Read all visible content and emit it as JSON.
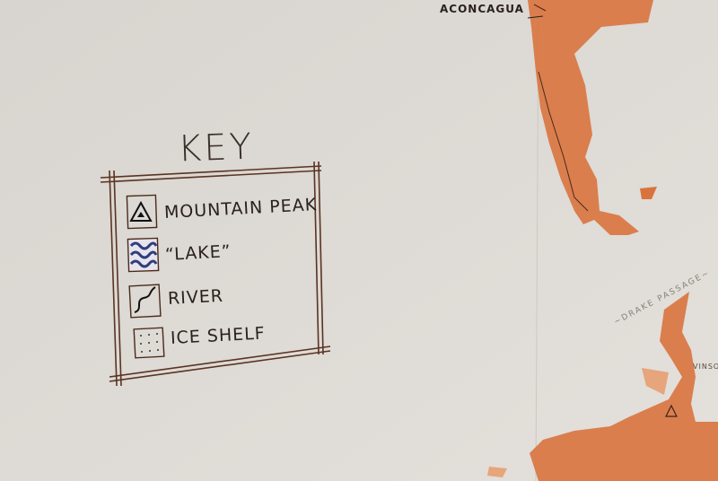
{
  "key": {
    "title": "KEY",
    "items": [
      {
        "label": "MOUNTAIN PEAK",
        "icon": "mountain-peak-icon"
      },
      {
        "label": "“LAKE”",
        "icon": "lake-icon"
      },
      {
        "label": "RIVER",
        "icon": "river-icon"
      },
      {
        "label": "ICE SHELF",
        "icon": "ice-shelf-icon"
      }
    ]
  },
  "map_labels": {
    "aconcagua": "ACONCAGUA",
    "drake_passage": "~DRAKE PASSAGE~",
    "vinson": "VINSON"
  },
  "colors": {
    "paper": "#dedad5",
    "land": "#d9733e",
    "ink": "#3a2418",
    "lake": "#2e3e7a"
  }
}
